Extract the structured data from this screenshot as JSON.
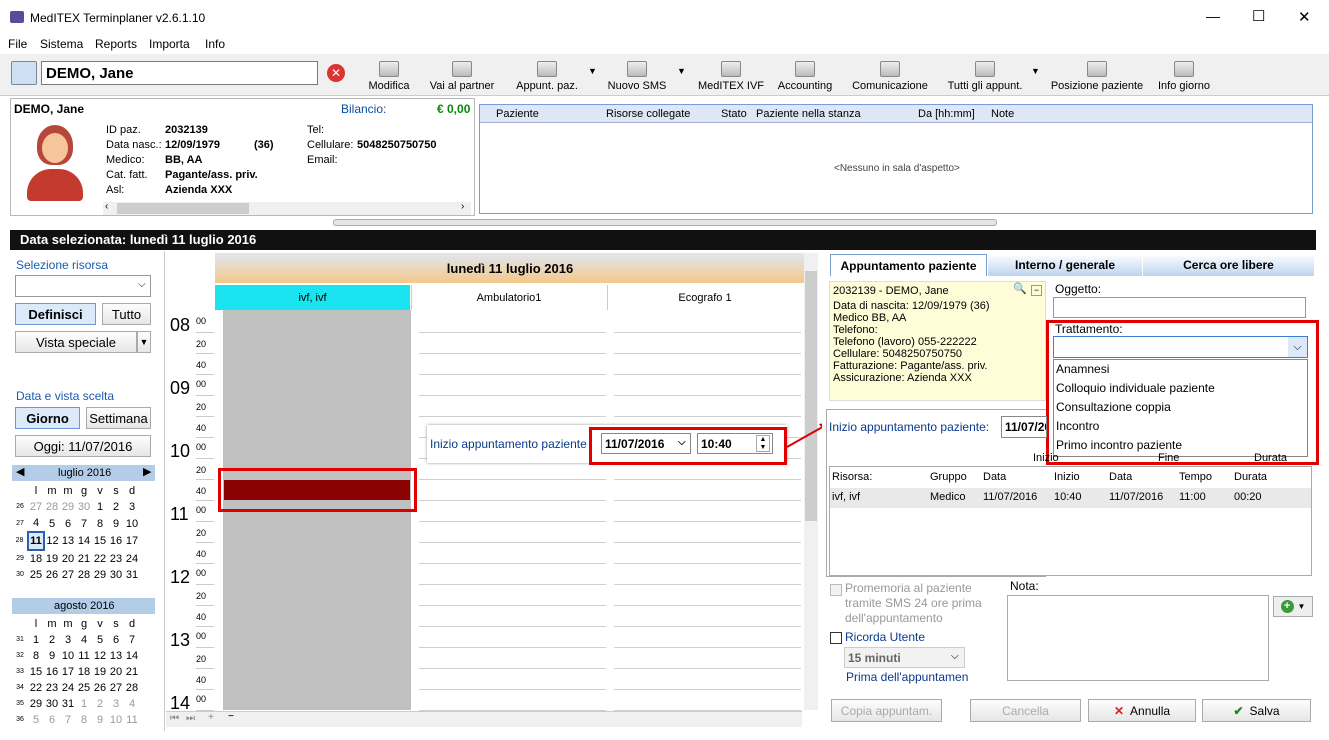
{
  "window": {
    "title": "MedITEX Terminplaner  v2.6.1.10",
    "min": "—",
    "max": "☐",
    "close": "✕"
  },
  "menu": [
    "File",
    "Sistema",
    "Reports",
    "Importa",
    "Info"
  ],
  "patient_search": {
    "value": "DEMO, Jane"
  },
  "toolbar": [
    {
      "label": "Modifica",
      "icon": "pen-icon"
    },
    {
      "label": "Vai al partner",
      "icon": "partner-icon"
    },
    {
      "label": "Appunt. paz.",
      "icon": "appointment-icon"
    },
    {
      "label": "Nuovo SMS",
      "icon": "sms-icon"
    },
    {
      "label": "MedITEX IVF",
      "icon": "ivf-icon"
    },
    {
      "label": "Accounting",
      "icon": "accounting-icon"
    },
    {
      "label": "Comunicazione",
      "icon": "communication-icon"
    },
    {
      "label": "Tutti gli appunt.",
      "icon": "list-icon"
    },
    {
      "label": "Posizione paziente",
      "icon": "position-icon"
    },
    {
      "label": "Info giorno",
      "icon": "info-icon"
    }
  ],
  "patient": {
    "name": "DEMO, Jane",
    "balance_label": "Bilancio:",
    "balance": "€ 0,00",
    "id_label": "ID paz.",
    "id": "2032139",
    "dob_label": "Data nasc.:",
    "dob": "12/09/1979",
    "age": "(36)",
    "doctor_label": "Medico:",
    "doctor": "BB, AA",
    "cat_label": "Cat. fatt.",
    "cat": "Pagante/ass. priv.",
    "asl_label": "Asl:",
    "asl": "Azienda XXX",
    "tel_label": "Tel:",
    "cell_label": "Cellulare:",
    "cell": "5048250750750",
    "email_label": "Email:"
  },
  "waiting": {
    "columns": [
      "Paziente",
      "Risorse collegate",
      "Stato",
      "Paziente nella stanza",
      "Da [hh:mm]",
      "Note"
    ],
    "empty": "<Nessuno in sala d'aspetto>"
  },
  "selected_date_bar": "Data selezionata:  lunedì 11 luglio 2016",
  "left": {
    "resource_label": "Selezione risorsa",
    "define": "Definisci",
    "all": "Tutto",
    "special_view": "Vista speciale",
    "date_view_label": "Data e vista scelta",
    "day": "Giorno",
    "week": "Settimana",
    "today": "Oggi: 11/07/2016",
    "weekdays": [
      "l",
      "m",
      "m",
      "g",
      "v",
      "s",
      "d"
    ],
    "july": {
      "title": "luglio 2016",
      "weeks": [
        [
          "26",
          "27",
          "28",
          "29",
          "30",
          "1",
          "2",
          "3"
        ],
        [
          "27",
          "4",
          "5",
          "6",
          "7",
          "8",
          "9",
          "10"
        ],
        [
          "28",
          "11",
          "12",
          "13",
          "14",
          "15",
          "16",
          "17"
        ],
        [
          "29",
          "18",
          "19",
          "20",
          "21",
          "22",
          "23",
          "24"
        ],
        [
          "30",
          "25",
          "26",
          "27",
          "28",
          "29",
          "30",
          "31"
        ]
      ]
    },
    "august": {
      "title": "agosto 2016",
      "weeks": [
        [
          "31",
          "1",
          "2",
          "3",
          "4",
          "5",
          "6",
          "7"
        ],
        [
          "32",
          "8",
          "9",
          "10",
          "11",
          "12",
          "13",
          "14"
        ],
        [
          "33",
          "15",
          "16",
          "17",
          "18",
          "19",
          "20",
          "21"
        ],
        [
          "34",
          "22",
          "23",
          "24",
          "25",
          "26",
          "27",
          "28"
        ],
        [
          "35",
          "29",
          "30",
          "31",
          "1",
          "2",
          "3",
          "4"
        ],
        [
          "36",
          "5",
          "6",
          "7",
          "8",
          "9",
          "10",
          "11"
        ]
      ]
    }
  },
  "calendar": {
    "day_title": "lunedì 11 luglio 2016",
    "columns": [
      "ivf, ivf",
      "Ambulatorio1",
      "Ecografo 1"
    ],
    "hours": [
      "08",
      "09",
      "10",
      "11",
      "12",
      "13",
      "14"
    ],
    "mins": [
      "00",
      "20",
      "40"
    ]
  },
  "popup_start": {
    "label": "Inizio appuntamento paziente",
    "date": "11/07/2016",
    "time": "10:40"
  },
  "tabs": [
    "Appuntamento paziente",
    "Interno / generale",
    "Cerca ore libere"
  ],
  "info": [
    "2032139 - DEMO, Jane",
    "Data di nascita: 12/09/1979 (36)",
    "Medico BB, AA",
    "Telefono:",
    "Telefono (lavoro) 055-222222",
    "Cellulare: 5048250750750",
    "Fatturazione: Pagante/ass. priv.",
    "Assicurazione: Azienda XXX"
  ],
  "form": {
    "subject_label": "Oggetto:",
    "treatment_label": "Trattamento:",
    "treatment_options": [
      "Anamnesi",
      "Colloquio individuale paziente",
      "Consultazione coppia",
      "Incontro",
      "Primo incontro paziente"
    ],
    "start_label": "Inizio appuntamento paziente:",
    "start_date": "11/07/20",
    "grid_top": [
      "Inizio",
      "Fine",
      "Durata"
    ],
    "grid_headers": [
      "Risorsa:",
      "Gruppo",
      "Data",
      "Inizio",
      "Data",
      "Tempo",
      "Durata"
    ],
    "grid_row": [
      "ivf, ivf",
      "Medico",
      "11/07/2016",
      "10:40",
      "11/07/2016",
      "11:00",
      "00:20"
    ],
    "sms_reminder": "Promemoria al paziente tramite SMS 24 ore prima dell'appuntamento",
    "remind_user": "Ricorda Utente",
    "minutes": "15 minuti",
    "before": "Prima dell'appuntamen",
    "note_label": "Nota:",
    "copy": "Copia appuntam.",
    "delete": "Cancella",
    "cancel": "Annulla",
    "save": "Salva"
  }
}
